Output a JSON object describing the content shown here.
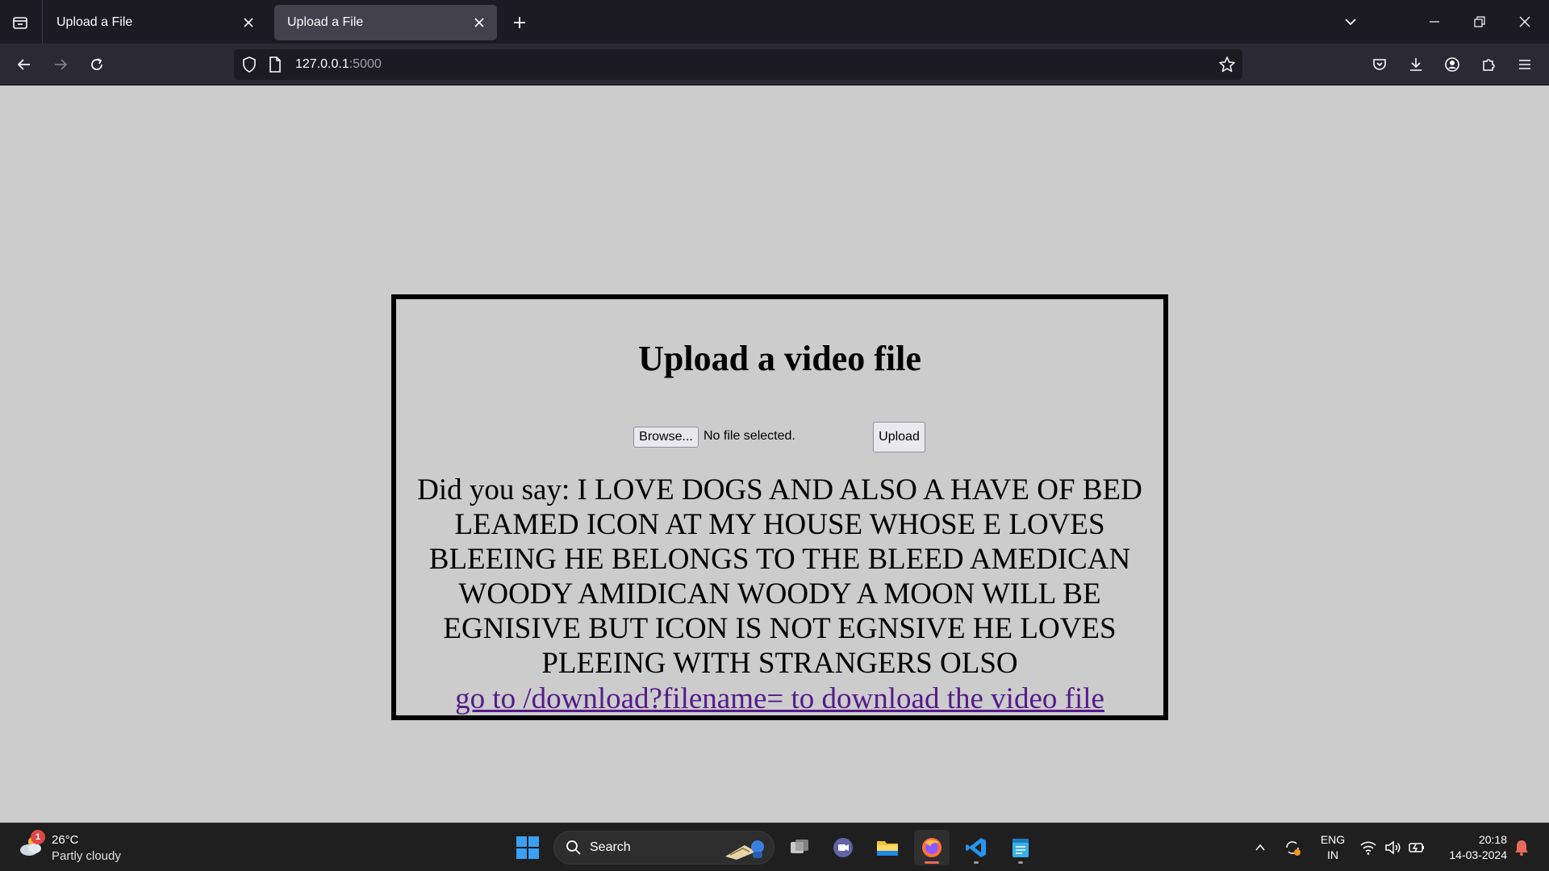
{
  "browser": {
    "tabs": [
      {
        "title": "Upload a File",
        "active": false
      },
      {
        "title": "Upload a File",
        "active": true
      }
    ],
    "url": {
      "host": "127.0.0.1",
      "port": ":5000"
    }
  },
  "page": {
    "heading": "Upload a video file",
    "browse_label": "Browse...",
    "file_status": "No file selected.",
    "upload_label": "Upload",
    "transcript": "Did you say: I LOVE DOGS AND ALSO A HAVE OF BED LEAMED ICON AT MY HOUSE WHOSE E LOVES BLEEING HE BELONGS TO THE BLEED AMEDICAN WOODY AMIDICAN WOODY A MOON WILL BE EGNISIVE BUT ICON IS NOT EGNSIVE HE LOVES PLEEING WITH STRANGERS OLSO",
    "download_link": "go to /download?filename= to download the video file"
  },
  "taskbar": {
    "weather": {
      "temp": "26°C",
      "desc": "Partly cloudy",
      "badge": "1"
    },
    "search_label": "Search",
    "lang_line1": "ENG",
    "lang_line2": "IN",
    "time": "20:18",
    "date": "14-03-2024"
  },
  "colors": {
    "page_bg": "#cccccc",
    "link_visited": "#551a8b",
    "chrome_dark": "#1c1b22",
    "taskbar_bg": "#1f1f1f"
  }
}
